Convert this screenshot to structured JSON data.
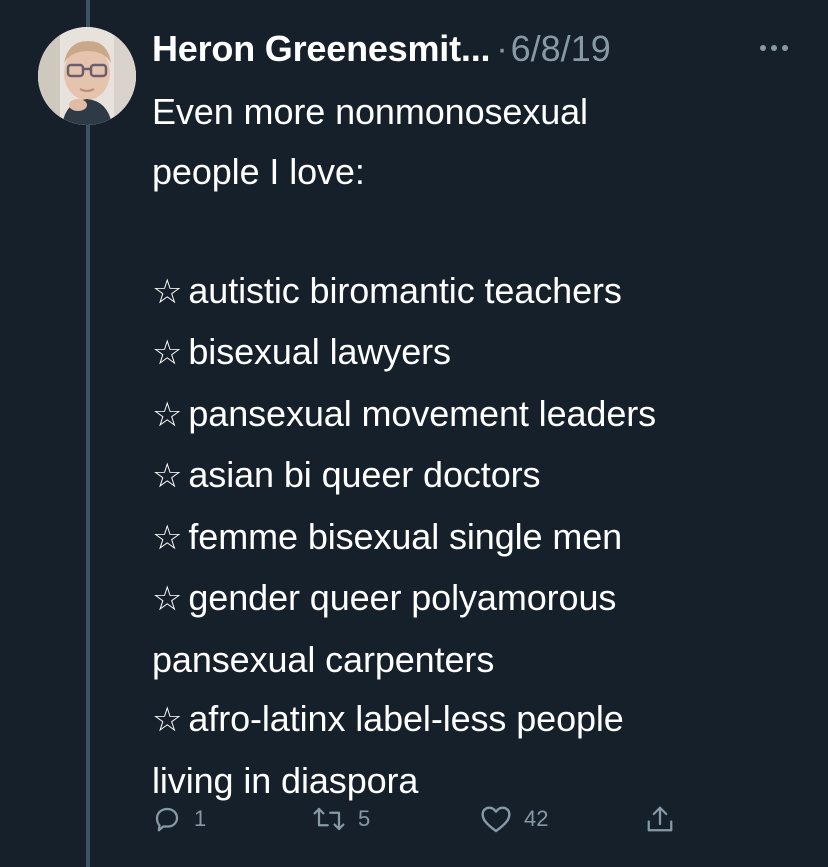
{
  "tweet": {
    "author_name": "Heron Greenesmit...",
    "separator": "·",
    "date": "6/8/19",
    "more_icon": "more-horizontal-icon",
    "text_intro_1": "Even more nonmonosexual",
    "text_intro_2": "people I love:",
    "star_glyph": "☆",
    "items": [
      "autistic biromantic teachers",
      "bisexual lawyers",
      "pansexual movement leaders",
      "asian bi queer doctors",
      "femme bisexual single men",
      "gender queer polyamorous"
    ],
    "item_6_continued": "pansexual carpenters",
    "item_7": "afro-latinx label-less people",
    "item_7_continued": "living in diaspora"
  },
  "actions": {
    "reply_icon": "reply-icon",
    "reply_count": "1",
    "retweet_icon": "retweet-icon",
    "retweet_count": "5",
    "like_icon": "heart-icon",
    "like_count": "42",
    "share_icon": "share-icon"
  },
  "colors": {
    "background": "#15202b",
    "primary_text": "#ffffff",
    "secondary_text": "#8899a6",
    "thread_line": "#3d5466"
  }
}
